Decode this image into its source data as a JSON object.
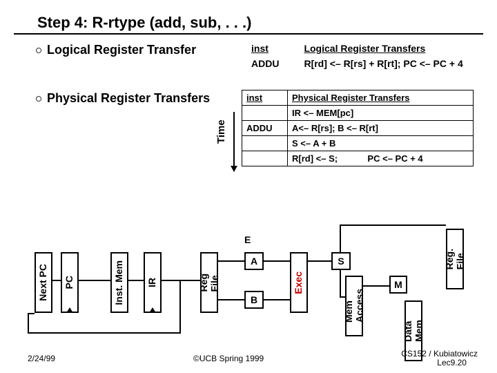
{
  "title": "Step 4: R-rtype (add, sub, . . .)",
  "bullets": {
    "logical": "Logical Register Transfer",
    "physical": "Physical Register Transfers"
  },
  "logical_table": {
    "cols": [
      "inst",
      "Logical Register Transfers"
    ],
    "row": [
      "ADDU",
      "R[rd] <– R[rs] + R[rt]; PC <– PC + 4"
    ]
  },
  "physical_table": {
    "cols": [
      "inst",
      "Physical Register Transfers"
    ],
    "rows": [
      [
        "",
        "IR <– MEM[pc]"
      ],
      [
        "ADDU",
        "A<– R[rs]; B <– R[rt]"
      ],
      [
        "",
        "S <– A + B"
      ],
      [
        "",
        "R[rd] <– S;            PC <– PC + 4"
      ]
    ]
  },
  "time_label": "Time",
  "blocks": {
    "nextpc": "Next PC",
    "pc": "PC",
    "instmem": "Inst. Mem",
    "ir": "IR",
    "regfile": "Reg\nFile",
    "A": "A",
    "B": "B",
    "E": "E",
    "exec": "Exec",
    "S": "S",
    "memacc": "Mem\nAccess",
    "M": "M",
    "datamem": "Data\nMem",
    "regfile2": "Reg.\nFile"
  },
  "footer": {
    "date": "2/24/99",
    "center": "©UCB Spring 1999",
    "right1": "CS152 / Kubiatowicz",
    "right2": "Lec9.20"
  }
}
